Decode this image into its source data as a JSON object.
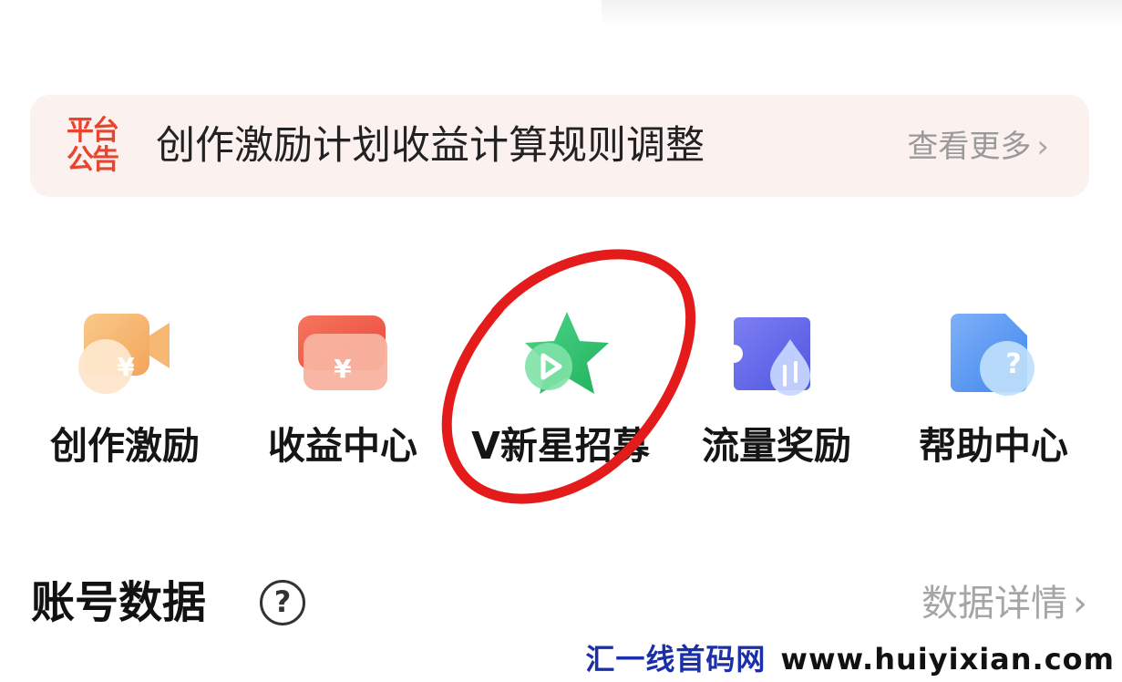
{
  "notice": {
    "tag_line1": "平台",
    "tag_line2": "公告",
    "title": "创作激励计划收益计算规则调整",
    "more_label": "查看更多"
  },
  "shortcuts": [
    {
      "label": "创作激励",
      "icon": "video-yuan-icon",
      "badge": "¥"
    },
    {
      "label": "收益中心",
      "icon": "wallet-yuan-icon",
      "badge": "¥"
    },
    {
      "label": "V新星招募",
      "icon": "star-play-icon"
    },
    {
      "label": "流量奖励",
      "icon": "ticket-drop-icon"
    },
    {
      "label": "帮助中心",
      "icon": "doc-question-icon",
      "badge": "?"
    }
  ],
  "account": {
    "title": "账号数据",
    "detail_label": "数据详情"
  },
  "watermark": {
    "site_name": "汇一线首码网",
    "url": "www.huiyixian.com"
  },
  "colors": {
    "accent_red": "#e8452e",
    "highlight_circle": "#e31b1b",
    "star_green": "#2fbf6a"
  }
}
